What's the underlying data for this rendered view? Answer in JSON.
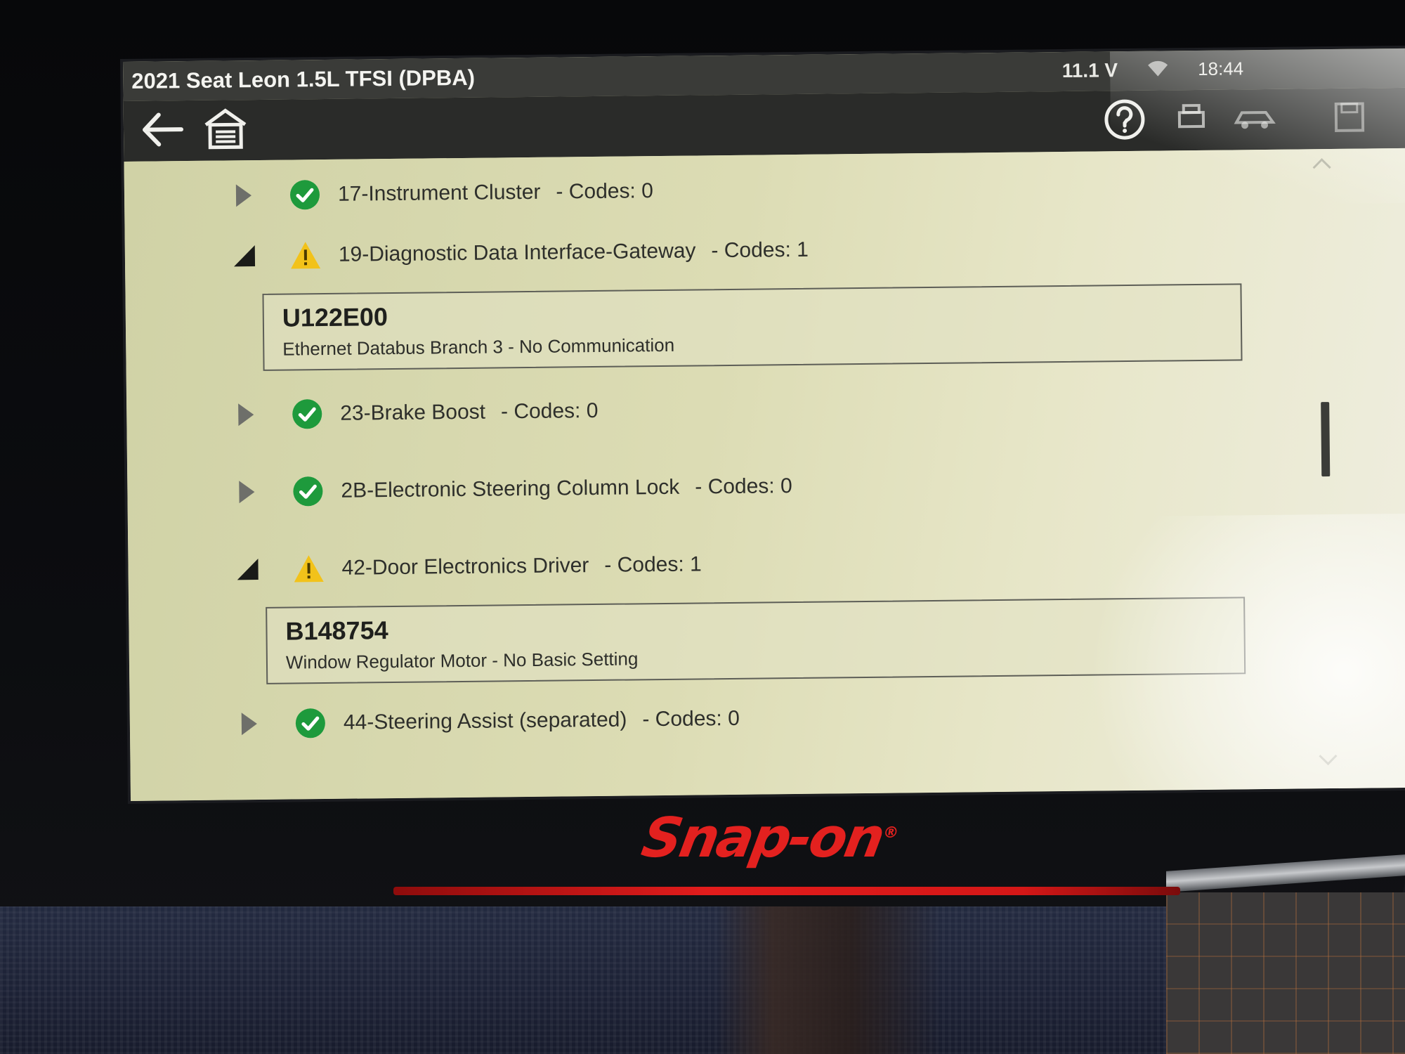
{
  "device": {
    "brand": "Snap-on",
    "brand_mark": "®"
  },
  "title_bar": {
    "vehicle": "2021 Seat Leon 1.5L TFSI (DPBA)",
    "voltage": "11.1 V",
    "clock": "18:44"
  },
  "toolbar": {
    "icons": [
      "back-arrow-icon",
      "home-icon",
      "help-icon",
      "print-icon",
      "vehicle-icon",
      "save-icon"
    ]
  },
  "modules": [
    {
      "name": "17-Instrument Cluster",
      "codes": "- Codes: 0",
      "status": "ok",
      "expanded": false
    },
    {
      "name": "19-Diagnostic Data Interface-Gateway",
      "codes": "- Codes: 1",
      "status": "warning",
      "expanded": true,
      "dtc": {
        "code": "U122E00",
        "description": "Ethernet Databus Branch 3 - No Communication"
      }
    },
    {
      "name": "23-Brake Boost",
      "codes": "- Codes: 0",
      "status": "ok",
      "expanded": false
    },
    {
      "name": "2B-Electronic Steering Column Lock",
      "codes": "- Codes: 0",
      "status": "ok",
      "expanded": false
    },
    {
      "name": "42-Door Electronics Driver",
      "codes": "- Codes: 1",
      "status": "warning",
      "expanded": true,
      "dtc": {
        "code": "B148754",
        "description": "Window Regulator Motor - No Basic Setting"
      }
    },
    {
      "name": "44-Steering Assist (separated)",
      "codes": "- Codes: 0",
      "status": "ok",
      "expanded": false
    }
  ],
  "colors": {
    "ok_green": "#1e9a3c",
    "warning_yellow": "#f2c21a",
    "screen_bg": "#d8d9b0",
    "title_bar": "#3a3b38",
    "brand_red": "#e3211f"
  }
}
